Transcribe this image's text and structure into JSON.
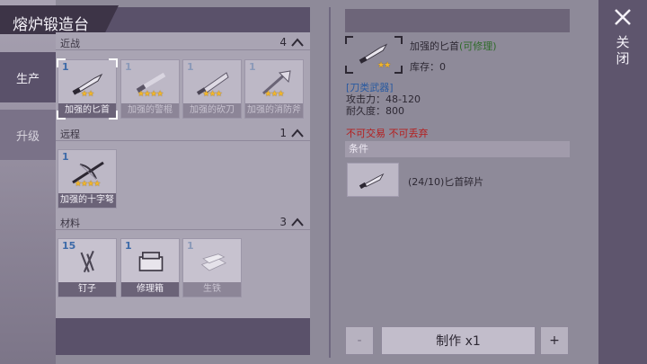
{
  "title": "熔炉锻造台",
  "side_tabs": {
    "produce": "生产",
    "upgrade": "升级"
  },
  "sections": [
    {
      "name": "近战",
      "count": "4"
    },
    {
      "name": "远程",
      "count": "1"
    },
    {
      "name": "材料",
      "count": "3"
    }
  ],
  "melee_items": [
    {
      "count": "1",
      "label": "加强的匕首",
      "stars": "★★",
      "icon": "dagger-icon"
    },
    {
      "count": "1",
      "label": "加强的警棍",
      "stars": "★★★★",
      "icon": "baton-icon"
    },
    {
      "count": "1",
      "label": "加强的砍刀",
      "stars": "★★★",
      "icon": "machete-icon"
    },
    {
      "count": "1",
      "label": "加强的消防斧",
      "stars": "★★★",
      "icon": "fire-axe-icon"
    }
  ],
  "ranged_items": [
    {
      "count": "1",
      "label": "加强的十字弩",
      "stars": "★★★★",
      "icon": "crossbow-icon"
    }
  ],
  "material_items": [
    {
      "count": "15",
      "label": "钉子",
      "icon": "nails-icon"
    },
    {
      "count": "1",
      "label": "修理箱",
      "icon": "repair-kit-icon"
    },
    {
      "count": "1",
      "label": "生铁",
      "icon": "pig-iron-icon"
    }
  ],
  "detail": {
    "name": "加强的匕首",
    "tradeable": "(可修理)",
    "stars": "★★",
    "stock": "库存：0",
    "category": "[刀类武器]",
    "attack": "攻击力：48-120",
    "durability": "耐久度：800",
    "restrictions": "不可交易 不可丢弃",
    "conditions_header": "条件",
    "condition_text": "(24/10)匕首碎片"
  },
  "controls": {
    "minus": "-",
    "craft": "制作 x1",
    "plus": "+"
  },
  "close_label": "关闭",
  "colors": {
    "panel_dark": "#5a516a",
    "star": "#f2b62a",
    "category_blue": "#2a5aa0",
    "warning_red": "#b51e1e"
  }
}
